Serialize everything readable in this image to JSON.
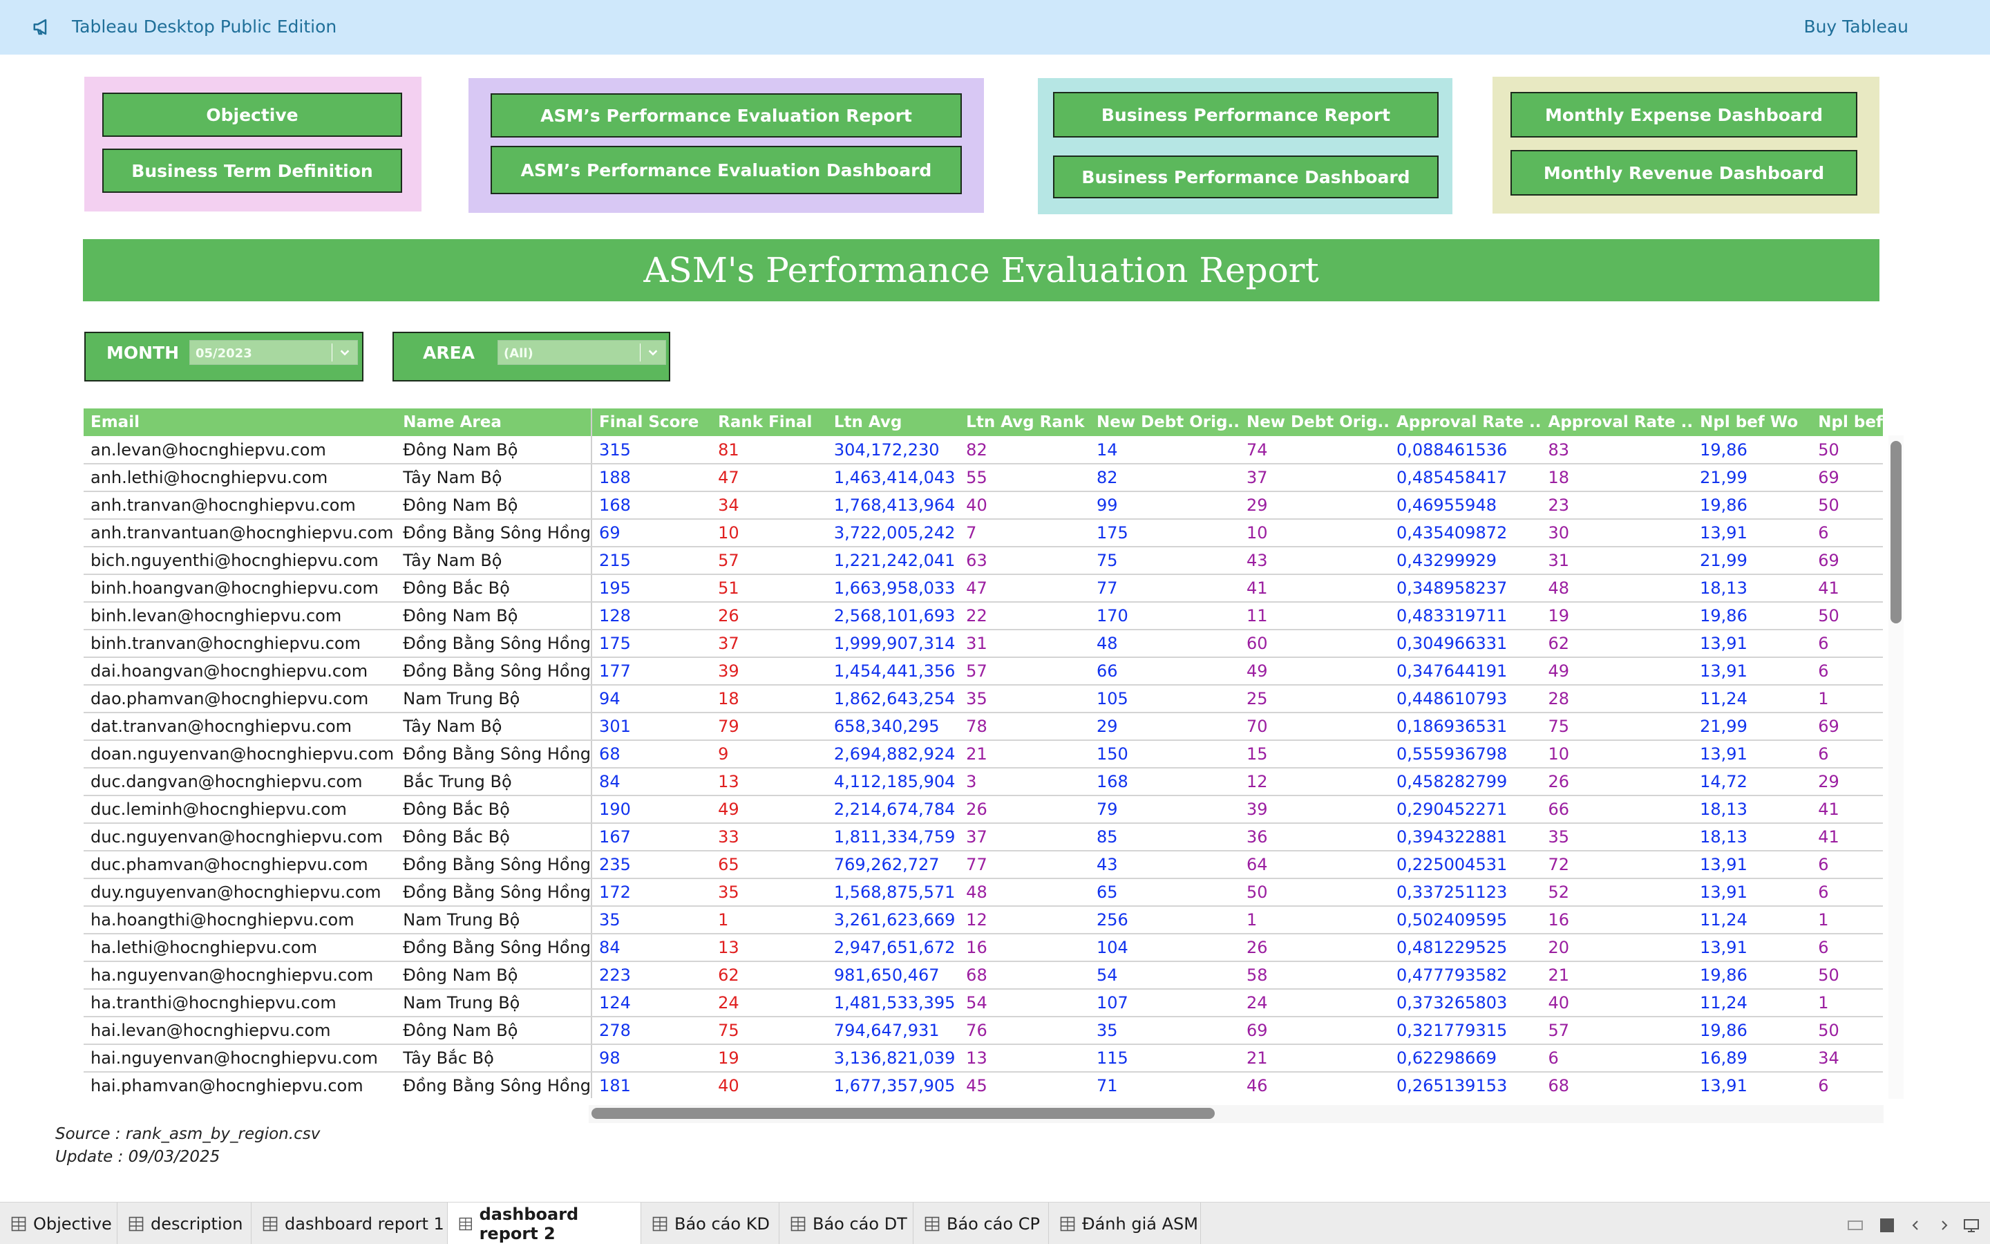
{
  "topbar": {
    "title": "Tableau Desktop Public Edition",
    "buy": "Buy Tableau",
    "icon": "megaphone-icon"
  },
  "nav": {
    "group1": [
      "Objective",
      "Business Term Definition"
    ],
    "group2": [
      "ASM’s Performance Evaluation Report",
      "ASM’s Performance Evaluation Dashboard"
    ],
    "group3": [
      "Business Performance Report",
      "Business Performance Dashboard"
    ],
    "group4": [
      "Monthly Expense Dashboard",
      "Monthly Revenue Dashboard"
    ],
    "colors": {
      "group1": "#f3d0f1",
      "group2": "#d8c8f4",
      "group3": "#b6e6e4",
      "group4": "#e8e9c2",
      "button": "#5cb85c"
    }
  },
  "banner": {
    "title": "ASM's Performance Evaluation Report"
  },
  "filters": {
    "month": {
      "label": "MONTH",
      "value": "05/2023"
    },
    "area": {
      "label": "AREA",
      "value": "(All)"
    }
  },
  "table": {
    "headers": [
      "Email",
      "Name Area",
      "Final Score",
      "Rank Final",
      "Ltn Avg",
      "Ltn Avg Rank",
      "New Debt Orig..",
      "New Debt Orig..",
      "Approval Rate ..",
      "Approval Rate ..",
      "Npl bef Wo",
      "Npl bef"
    ],
    "rows": [
      [
        "an.levan@hocnghiepvu.com",
        "Đông Nam Bộ",
        "315",
        "81",
        "304,172,230",
        "82",
        "14",
        "74",
        "0,088461536",
        "83",
        "19,86",
        "50"
      ],
      [
        "anh.lethi@hocnghiepvu.com",
        "Tây Nam Bộ",
        "188",
        "47",
        "1,463,414,043",
        "55",
        "82",
        "37",
        "0,485458417",
        "18",
        "21,99",
        "69"
      ],
      [
        "anh.tranvan@hocnghiepvu.com",
        "Đông Nam Bộ",
        "168",
        "34",
        "1,768,413,964",
        "40",
        "99",
        "29",
        "0,46955948",
        "23",
        "19,86",
        "50"
      ],
      [
        "anh.tranvantuan@hocnghiepvu.com",
        "Đồng Bằng Sông Hồng",
        "69",
        "10",
        "3,722,005,242",
        "7",
        "175",
        "10",
        "0,435409872",
        "30",
        "13,91",
        "6"
      ],
      [
        "bich.nguyenthi@hocnghiepvu.com",
        "Tây Nam Bộ",
        "215",
        "57",
        "1,221,242,041",
        "63",
        "75",
        "43",
        "0,43299929",
        "31",
        "21,99",
        "69"
      ],
      [
        "binh.hoangvan@hocnghiepvu.com",
        "Đông Bắc Bộ",
        "195",
        "51",
        "1,663,958,033",
        "47",
        "77",
        "41",
        "0,348958237",
        "48",
        "18,13",
        "41"
      ],
      [
        "binh.levan@hocnghiepvu.com",
        "Đông Nam Bộ",
        "128",
        "26",
        "2,568,101,693",
        "22",
        "170",
        "11",
        "0,483319711",
        "19",
        "19,86",
        "50"
      ],
      [
        "binh.tranvan@hocnghiepvu.com",
        "Đồng Bằng Sông Hồng",
        "175",
        "37",
        "1,999,907,314",
        "31",
        "48",
        "60",
        "0,304966331",
        "62",
        "13,91",
        "6"
      ],
      [
        "dai.hoangvan@hocnghiepvu.com",
        "Đồng Bằng Sông Hồng",
        "177",
        "39",
        "1,454,441,356",
        "57",
        "66",
        "49",
        "0,347644191",
        "49",
        "13,91",
        "6"
      ],
      [
        "dao.phamvan@hocnghiepvu.com",
        "Nam Trung Bộ",
        "94",
        "18",
        "1,862,643,254",
        "35",
        "105",
        "25",
        "0,448610793",
        "28",
        "11,24",
        "1"
      ],
      [
        "dat.tranvan@hocnghiepvu.com",
        "Tây Nam Bộ",
        "301",
        "79",
        "658,340,295",
        "78",
        "29",
        "70",
        "0,186936531",
        "75",
        "21,99",
        "69"
      ],
      [
        "doan.nguyenvan@hocnghiepvu.com",
        "Đồng Bằng Sông Hồng",
        "68",
        "9",
        "2,694,882,924",
        "21",
        "150",
        "15",
        "0,555936798",
        "10",
        "13,91",
        "6"
      ],
      [
        "duc.dangvan@hocnghiepvu.com",
        "Bắc Trung Bộ",
        "84",
        "13",
        "4,112,185,904",
        "3",
        "168",
        "12",
        "0,458282799",
        "26",
        "14,72",
        "29"
      ],
      [
        "duc.leminh@hocnghiepvu.com",
        "Đông Bắc Bộ",
        "190",
        "49",
        "2,214,674,784",
        "26",
        "79",
        "39",
        "0,290452271",
        "66",
        "18,13",
        "41"
      ],
      [
        "duc.nguyenvan@hocnghiepvu.com",
        "Đông Bắc Bộ",
        "167",
        "33",
        "1,811,334,759",
        "37",
        "85",
        "36",
        "0,394322881",
        "35",
        "18,13",
        "41"
      ],
      [
        "duc.phamvan@hocnghiepvu.com",
        "Đồng Bằng Sông Hồng",
        "235",
        "65",
        "769,262,727",
        "77",
        "43",
        "64",
        "0,225004531",
        "72",
        "13,91",
        "6"
      ],
      [
        "duy.nguyenvan@hocnghiepvu.com",
        "Đồng Bằng Sông Hồng",
        "172",
        "35",
        "1,568,875,571",
        "48",
        "65",
        "50",
        "0,337251123",
        "52",
        "13,91",
        "6"
      ],
      [
        "ha.hoangthi@hocnghiepvu.com",
        "Nam Trung Bộ",
        "35",
        "1",
        "3,261,623,669",
        "12",
        "256",
        "1",
        "0,502409595",
        "16",
        "11,24",
        "1"
      ],
      [
        "ha.lethi@hocnghiepvu.com",
        "Đồng Bằng Sông Hồng",
        "84",
        "13",
        "2,947,651,672",
        "16",
        "104",
        "26",
        "0,481229525",
        "20",
        "13,91",
        "6"
      ],
      [
        "ha.nguyenvan@hocnghiepvu.com",
        "Đông Nam Bộ",
        "223",
        "62",
        "981,650,467",
        "68",
        "54",
        "58",
        "0,477793582",
        "21",
        "19,86",
        "50"
      ],
      [
        "ha.tranthi@hocnghiepvu.com",
        "Nam Trung Bộ",
        "124",
        "24",
        "1,481,533,395",
        "54",
        "107",
        "24",
        "0,373265803",
        "40",
        "11,24",
        "1"
      ],
      [
        "hai.levan@hocnghiepvu.com",
        "Đông Nam Bộ",
        "278",
        "75",
        "794,647,931",
        "76",
        "35",
        "69",
        "0,321779315",
        "57",
        "19,86",
        "50"
      ],
      [
        "hai.nguyenvan@hocnghiepvu.com",
        "Tây Bắc Bộ",
        "98",
        "19",
        "3,136,821,039",
        "13",
        "115",
        "21",
        "0,62298669",
        "6",
        "16,89",
        "34"
      ],
      [
        "hai.phamvan@hocnghiepvu.com",
        "Đồng Bằng Sông Hồng",
        "181",
        "40",
        "1,677,357,905",
        "45",
        "71",
        "46",
        "0,265139153",
        "68",
        "13,91",
        "6"
      ]
    ]
  },
  "footer": {
    "source": "Source : rank_asm_by_region.csv",
    "update": "Update : 09/03/2025"
  },
  "tabs": [
    "Objective",
    "description",
    "dashboard report 1",
    "dashboard report 2",
    "Báo cáo KD",
    "Báo cáo DT",
    "Báo cáo CP",
    "Đánh giá ASM"
  ],
  "active_tab": "dashboard report 2",
  "colors": {
    "header_green": "#7ccc70",
    "value_blue": "#1133ee",
    "rank_red": "#e02020",
    "rank_purple": "#9b1ea0"
  }
}
